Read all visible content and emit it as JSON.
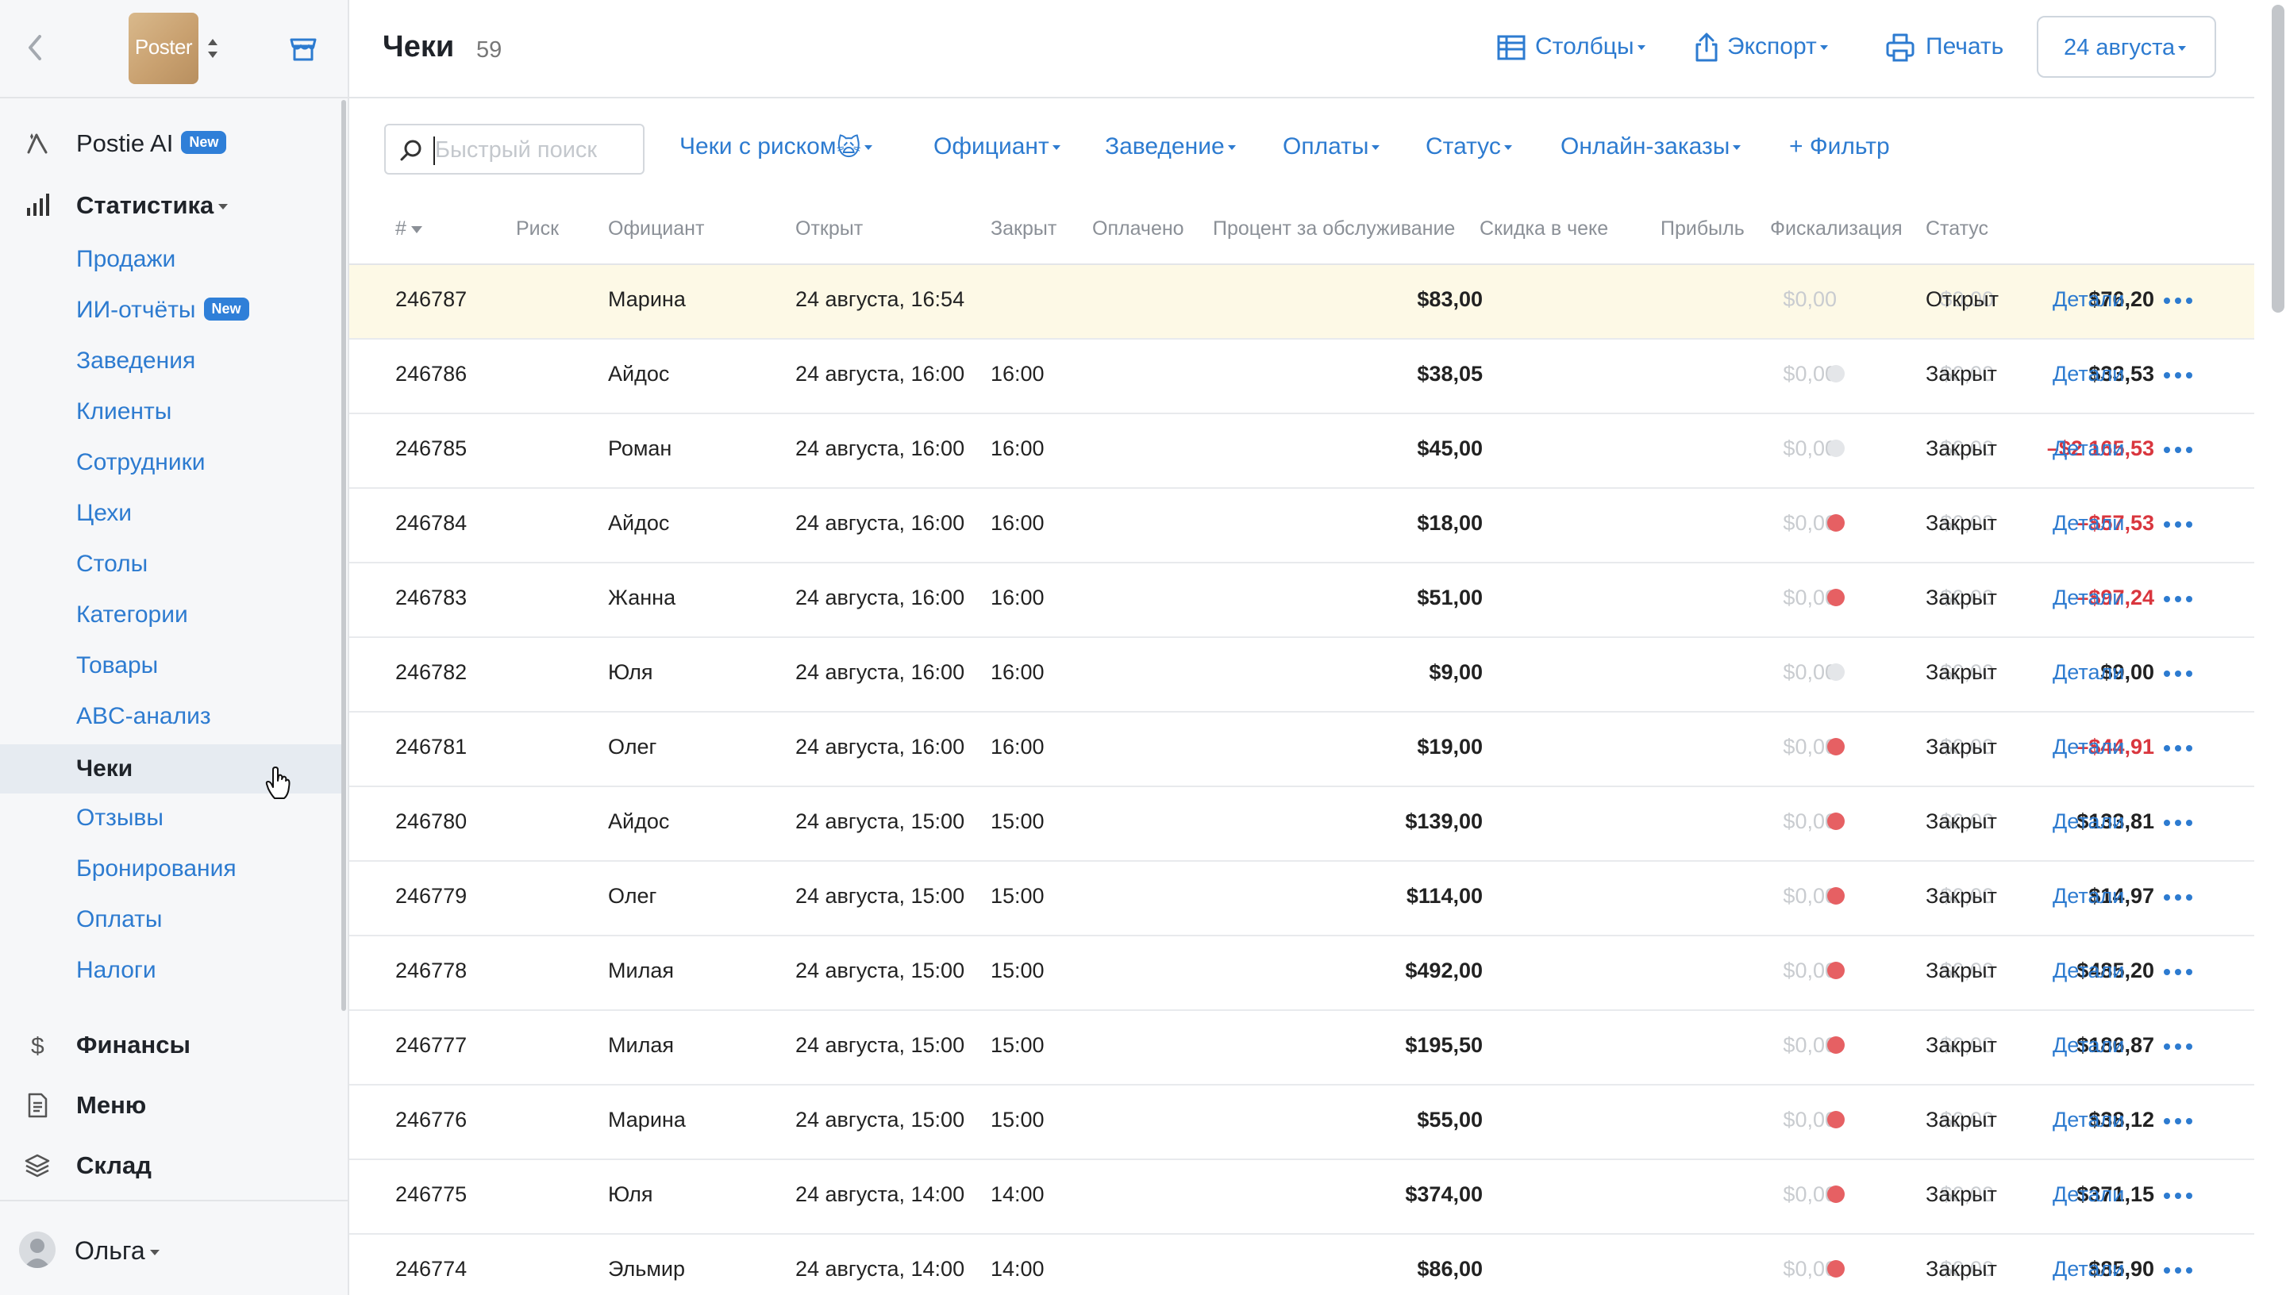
{
  "sidebar": {
    "logo_text": "Poster",
    "postie": {
      "label": "Postie AI",
      "badge": "New"
    },
    "statistics": {
      "label": "Статистика"
    },
    "stats_items": [
      {
        "label": "Продажи"
      },
      {
        "label": "ИИ-отчёты",
        "badge": "New"
      },
      {
        "label": "Заведения"
      },
      {
        "label": "Клиенты"
      },
      {
        "label": "Сотрудники"
      },
      {
        "label": "Цехи"
      },
      {
        "label": "Столы"
      },
      {
        "label": "Категории"
      },
      {
        "label": "Товары"
      },
      {
        "label": "ABC-анализ"
      },
      {
        "label": "Чеки",
        "active": true
      },
      {
        "label": "Отзывы"
      },
      {
        "label": "Бронирования"
      },
      {
        "label": "Оплаты"
      },
      {
        "label": "Налоги"
      }
    ],
    "finance": {
      "label": "Финансы"
    },
    "menu": {
      "label": "Меню"
    },
    "warehouse": {
      "label": "Склад"
    },
    "user": {
      "name": "Ольга"
    }
  },
  "header": {
    "title": "Чеки",
    "count": "59",
    "columns_label": "Столбцы",
    "export_label": "Экспорт",
    "print_label": "Печать",
    "date_label": "24 августа"
  },
  "filters": {
    "search_placeholder": "Быстрый поиск",
    "risk_label": "Чеки с риском",
    "risk_emoji": "🙀",
    "waiter_label": "Официант",
    "venue_label": "Заведение",
    "payments_label": "Оплаты",
    "status_label": "Статус",
    "online_label": "Онлайн-заказы",
    "add_filter_label": "+ Фильтр"
  },
  "table": {
    "columns": {
      "num": "#",
      "risk": "Риск",
      "waiter": "Официант",
      "opened": "Открыт",
      "closed": "Закрыт",
      "paid": "Оплачено",
      "service": "Процент за обслуживание",
      "discount": "Скидка в чеке",
      "profit": "Прибыль",
      "fiscal": "Фискализация",
      "status": "Статус"
    },
    "details_label": "Детали",
    "rows": [
      {
        "num": "246787",
        "waiter": "Марина",
        "opened": "24 августа, 16:54",
        "closed": "",
        "paid": "$83,00",
        "service": "$0,00",
        "discount": "$0,00",
        "profit": "$76,20",
        "profit_negative": false,
        "fiscal": "none",
        "status": "Открыт",
        "highlight": true
      },
      {
        "num": "246786",
        "waiter": "Айдос",
        "opened": "24 августа, 16:00",
        "closed": "16:00",
        "paid": "$38,05",
        "service": "$0,00",
        "discount": "$0,00",
        "profit": "$33,53",
        "profit_negative": false,
        "fiscal": "gray",
        "status": "Закрыт"
      },
      {
        "num": "246785",
        "waiter": "Роман",
        "opened": "24 августа, 16:00",
        "closed": "16:00",
        "paid": "$45,00",
        "service": "$0,00",
        "discount": "$0,00",
        "profit": "–$2 165,53",
        "profit_negative": true,
        "fiscal": "gray",
        "status": "Закрыт"
      },
      {
        "num": "246784",
        "waiter": "Айдос",
        "opened": "24 августа, 16:00",
        "closed": "16:00",
        "paid": "$18,00",
        "service": "$0,00",
        "discount": "$0,00",
        "profit": "–$57,53",
        "profit_negative": true,
        "fiscal": "red",
        "status": "Закрыт"
      },
      {
        "num": "246783",
        "waiter": "Жанна",
        "opened": "24 августа, 16:00",
        "closed": "16:00",
        "paid": "$51,00",
        "service": "$0,00",
        "discount": "$0,00",
        "profit": "–$97,24",
        "profit_negative": true,
        "fiscal": "red",
        "status": "Закрыт"
      },
      {
        "num": "246782",
        "waiter": "Юля",
        "opened": "24 августа, 16:00",
        "closed": "16:00",
        "paid": "$9,00",
        "service": "$0,00",
        "discount": "$0,00",
        "profit": "$9,00",
        "profit_negative": false,
        "fiscal": "gray",
        "status": "Закрыт"
      },
      {
        "num": "246781",
        "waiter": "Олег",
        "opened": "24 августа, 16:00",
        "closed": "16:00",
        "paid": "$19,00",
        "service": "$0,00",
        "discount": "$0,00",
        "profit": "–$44,91",
        "profit_negative": true,
        "fiscal": "red",
        "status": "Закрыт"
      },
      {
        "num": "246780",
        "waiter": "Айдос",
        "opened": "24 августа, 15:00",
        "closed": "15:00",
        "paid": "$139,00",
        "service": "$0,00",
        "discount": "$0,00",
        "profit": "$133,81",
        "profit_negative": false,
        "fiscal": "red",
        "status": "Закрыт"
      },
      {
        "num": "246779",
        "waiter": "Олег",
        "opened": "24 августа, 15:00",
        "closed": "15:00",
        "paid": "$114,00",
        "service": "$0,00",
        "discount": "$0,00",
        "profit": "$14,97",
        "profit_negative": false,
        "fiscal": "red",
        "status": "Закрыт"
      },
      {
        "num": "246778",
        "waiter": "Милая",
        "opened": "24 августа, 15:00",
        "closed": "15:00",
        "paid": "$492,00",
        "service": "$0,00",
        "discount": "$0,00",
        "profit": "$485,20",
        "profit_negative": false,
        "fiscal": "red",
        "status": "Закрыт"
      },
      {
        "num": "246777",
        "waiter": "Милая",
        "opened": "24 августа, 15:00",
        "closed": "15:00",
        "paid": "$195,50",
        "service": "$0,00",
        "discount": "$0,00",
        "profit": "$186,87",
        "profit_negative": false,
        "fiscal": "red",
        "status": "Закрыт"
      },
      {
        "num": "246776",
        "waiter": "Марина",
        "opened": "24 августа, 15:00",
        "closed": "15:00",
        "paid": "$55,00",
        "service": "$0,00",
        "discount": "$0,00",
        "profit": "$38,12",
        "profit_negative": false,
        "fiscal": "red",
        "status": "Закрыт"
      },
      {
        "num": "246775",
        "waiter": "Юля",
        "opened": "24 августа, 14:00",
        "closed": "14:00",
        "paid": "$374,00",
        "service": "$0,00",
        "discount": "$0,00",
        "profit": "$371,15",
        "profit_negative": false,
        "fiscal": "red",
        "status": "Закрыт"
      },
      {
        "num": "246774",
        "waiter": "Эльмир",
        "opened": "24 августа, 14:00",
        "closed": "14:00",
        "paid": "$86,00",
        "service": "$0,00",
        "discount": "$0,00",
        "profit": "$85,90",
        "profit_negative": false,
        "fiscal": "red",
        "status": "Закрыт"
      }
    ]
  },
  "colors": {
    "accent": "#2d7bd0",
    "negative": "#d9363e",
    "fiscal_red": "#e66063",
    "fiscal_gray": "#e4e6e9",
    "highlight_row": "#fdf9e6",
    "sidebar_bg": "#f6f7f9"
  },
  "icons": {
    "back": "chevron-left-icon",
    "store": "store-icon",
    "postie": "sparkle-pen-icon",
    "statistics": "bar-chart-icon",
    "finance": "dollar-icon",
    "menu": "document-icon",
    "warehouse": "layers-icon",
    "columns": "table-icon",
    "export": "export-icon",
    "print": "printer-icon",
    "search": "search-icon",
    "more": "more-dots-icon"
  }
}
